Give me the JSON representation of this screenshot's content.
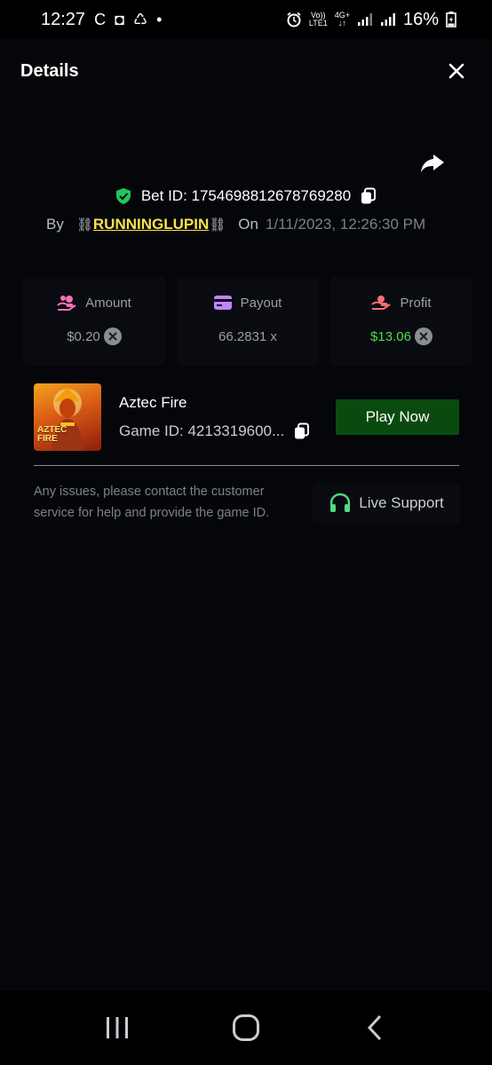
{
  "status_bar": {
    "time": "12:27",
    "glyph_1": "C",
    "glyph_2": "◘",
    "glyph_3": "♺",
    "dot": "•",
    "volte_top": "Vo))",
    "volte_bottom": "LTE1",
    "network_top": "4G+",
    "network_bottom": "↓↑",
    "battery": "16%"
  },
  "header": {
    "title": "Details"
  },
  "bet": {
    "label": "Bet ID: 1754698812678769280"
  },
  "byline": {
    "by_label": "By",
    "chain": "⛓",
    "username": "RUNNINGLUPIN",
    "on_label": "On",
    "date": "1/11/2023, 12:26:30 PM"
  },
  "stats": [
    {
      "label": "Amount",
      "value": "$0.20",
      "icon": "coins-hand-icon"
    },
    {
      "label": "Payout",
      "value": "66.2831 x",
      "icon": "card-icon"
    },
    {
      "label": "Profit",
      "value": "$13.06",
      "icon": "profit-hand-icon"
    }
  ],
  "game": {
    "name": "Aztec Fire",
    "id_text": "Game ID: 4213319600...",
    "thumb_line_1": "AZTEC",
    "thumb_line_2": "FIRE",
    "play_label": "Play Now"
  },
  "support": {
    "text": "Any issues, please contact the customer service for help and provide the game ID.",
    "button_label": "Live Support"
  },
  "colors": {
    "accent_green": "#4ade4a",
    "play_button": "#0b4a0f",
    "username_yellow": "#f7e24a",
    "amount_icon": "#f472b6",
    "payout_icon": "#c084fc",
    "profit_icon": "#f87171"
  }
}
